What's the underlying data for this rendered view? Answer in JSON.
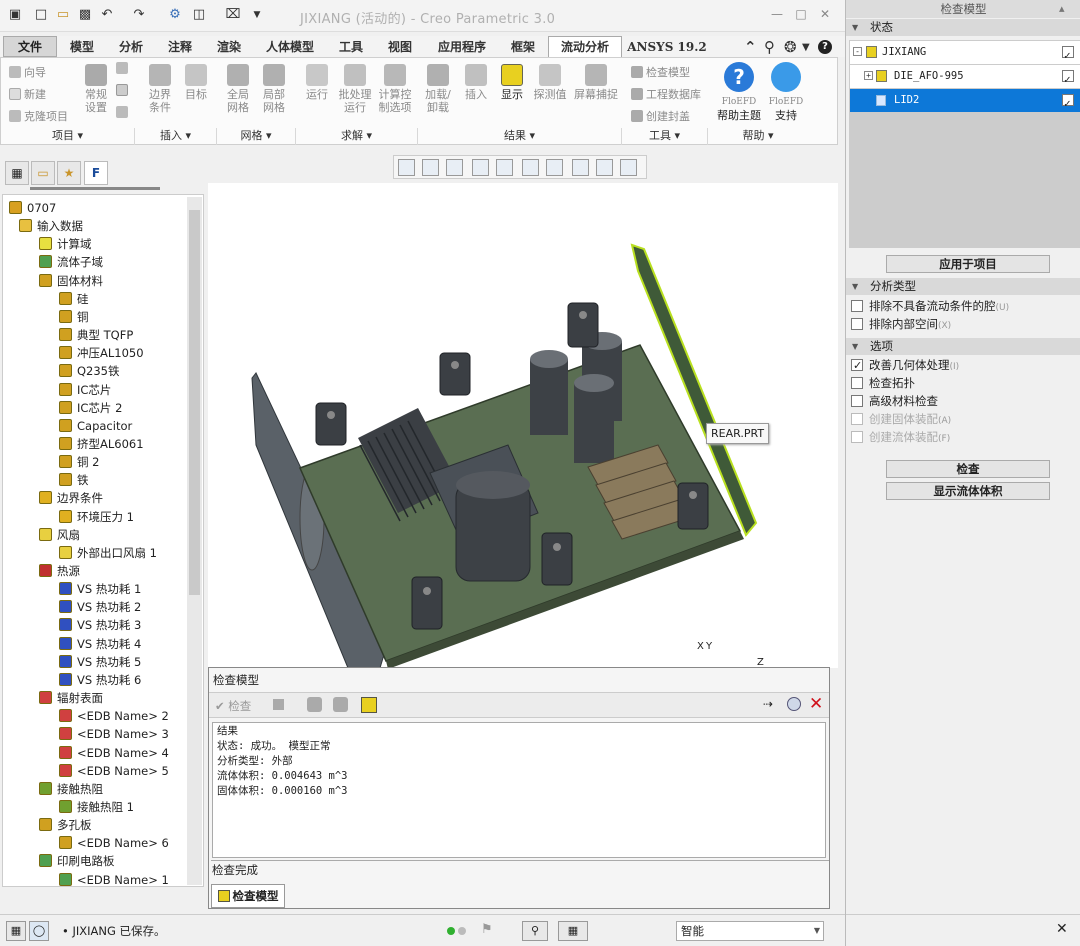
{
  "app": {
    "title": "JIXIANG (活动的) - Creo Parametric 3.0"
  },
  "quick_access": [
    "app-icon",
    "new-icon",
    "open-icon",
    "save-icon",
    "undo-icon",
    "redo-icon",
    "regenerate-icon",
    "window-icon",
    "close-window-icon",
    "customize-icon"
  ],
  "tabs": [
    "文件",
    "模型",
    "分析",
    "注释",
    "渲染",
    "人体模型",
    "工具",
    "视图",
    "应用程序",
    "框架",
    "流动分析",
    "ANSYS 19.2"
  ],
  "ribbon": {
    "project_small": [
      "向导",
      "新建",
      "克隆项目"
    ],
    "project_large": [
      [
        "常规",
        "设置"
      ]
    ],
    "insert": [
      [
        "边界",
        "条件"
      ],
      [
        "目标",
        ""
      ]
    ],
    "mesh": [
      [
        "全局",
        "网格"
      ],
      [
        "局部",
        "网格"
      ]
    ],
    "solve": [
      [
        "运行",
        ""
      ],
      [
        "批处理",
        "运行"
      ],
      [
        "计算控",
        "制选项"
      ]
    ],
    "results": [
      [
        "加载/",
        "卸载"
      ],
      [
        "插入",
        ""
      ],
      [
        "显示",
        ""
      ],
      [
        "探测值",
        ""
      ],
      [
        "屏幕捕捉",
        ""
      ]
    ],
    "tools_small": [
      "检查模型",
      "工程数据库",
      "创建封盖"
    ],
    "help": [
      [
        "FloEFD",
        "帮助主题"
      ],
      [
        "FloEFD",
        "支持"
      ]
    ],
    "groups": [
      "项目",
      "插入",
      "网格",
      "求解",
      "结果",
      "工具",
      "帮助"
    ]
  },
  "tree": {
    "items": [
      {
        "label": "0707",
        "level": 0,
        "color": "#d8a020"
      },
      {
        "label": "输入数据",
        "level": 1,
        "color": "#e8c040"
      },
      {
        "label": "计算域",
        "level": 2,
        "color": "#e8e040"
      },
      {
        "label": "流体子域",
        "level": 2,
        "color": "#50a050"
      },
      {
        "label": "固体材料",
        "level": 2,
        "color": "#d0a020"
      },
      {
        "label": "硅",
        "level": 3,
        "color": "#d0a020"
      },
      {
        "label": "铜",
        "level": 3,
        "color": "#d0a020"
      },
      {
        "label": "典型 TQFP",
        "level": 3,
        "color": "#d0a020"
      },
      {
        "label": "冲压AL1050",
        "level": 3,
        "color": "#d0a020"
      },
      {
        "label": "Q235铁",
        "level": 3,
        "color": "#d0a020"
      },
      {
        "label": "IC芯片",
        "level": 3,
        "color": "#d0a020"
      },
      {
        "label": "IC芯片 2",
        "level": 3,
        "color": "#d0a020"
      },
      {
        "label": "Capacitor",
        "level": 3,
        "color": "#d0a020"
      },
      {
        "label": "挤型AL6061",
        "level": 3,
        "color": "#d0a020"
      },
      {
        "label": "铜 2",
        "level": 3,
        "color": "#d0a020"
      },
      {
        "label": "铁",
        "level": 3,
        "color": "#d0a020"
      },
      {
        "label": "边界条件",
        "level": 2,
        "color": "#e0b020"
      },
      {
        "label": "环境压力 1",
        "level": 3,
        "color": "#e0b020"
      },
      {
        "label": "风扇",
        "level": 2,
        "color": "#e8d040"
      },
      {
        "label": "外部出口风扇 1",
        "level": 3,
        "color": "#e8d040"
      },
      {
        "label": "热源",
        "level": 2,
        "color": "#c03030"
      },
      {
        "label": "VS 热功耗 1",
        "level": 3,
        "color": "#3050c0"
      },
      {
        "label": "VS 热功耗 2",
        "level": 3,
        "color": "#3050c0"
      },
      {
        "label": "VS 热功耗 3",
        "level": 3,
        "color": "#3050c0"
      },
      {
        "label": "VS 热功耗 4",
        "level": 3,
        "color": "#3050c0"
      },
      {
        "label": "VS 热功耗 5",
        "level": 3,
        "color": "#3050c0"
      },
      {
        "label": "VS 热功耗 6",
        "level": 3,
        "color": "#3050c0"
      },
      {
        "label": "辐射表面",
        "level": 2,
        "color": "#d04040"
      },
      {
        "label": "<EDB Name> 2",
        "level": 3,
        "color": "#d04040"
      },
      {
        "label": "<EDB Name> 3",
        "level": 3,
        "color": "#d04040"
      },
      {
        "label": "<EDB Name> 4",
        "level": 3,
        "color": "#d04040"
      },
      {
        "label": "<EDB Name> 5",
        "level": 3,
        "color": "#d04040"
      },
      {
        "label": "接触热阻",
        "level": 2,
        "color": "#70a030"
      },
      {
        "label": "接触热阻 1",
        "level": 3,
        "color": "#70a030"
      },
      {
        "label": "多孔板",
        "level": 2,
        "color": "#d0a020"
      },
      {
        "label": "<EDB Name> 6",
        "level": 3,
        "color": "#d0a020"
      },
      {
        "label": "印刷电路板",
        "level": 2,
        "color": "#50a050"
      },
      {
        "label": "<EDB Name> 1",
        "level": 3,
        "color": "#50a050"
      }
    ]
  },
  "viewport": {
    "tooltip": "REAR.PRT",
    "axis_x": "X",
    "axis_y": "Y",
    "axis_z": "Z"
  },
  "right_panel": {
    "title": "检查模型",
    "status_label": "状态",
    "status_items": [
      {
        "label": "JIXIANG",
        "checked": true
      },
      {
        "label": "DIE_AFO-995",
        "checked": true
      },
      {
        "label": "LID2",
        "checked": true
      }
    ],
    "apply_button": "应用于项目",
    "analysis_label": "分析类型",
    "analysis_opts": [
      {
        "label": "排除不具备流动条件的腔",
        "key": "(U)",
        "checked": false,
        "disabled": false
      },
      {
        "label": "排除内部空间",
        "key": "(X)",
        "checked": false,
        "disabled": false
      }
    ],
    "options_label": "选项",
    "options": [
      {
        "label": "改善几何体处理",
        "key": "(I)",
        "checked": true,
        "disabled": false
      },
      {
        "label": "检查拓扑",
        "key": "",
        "checked": false,
        "disabled": false
      },
      {
        "label": "高级材料检查",
        "key": "",
        "checked": false,
        "disabled": false
      },
      {
        "label": "创建固体装配",
        "key": "(A)",
        "checked": false,
        "disabled": true
      },
      {
        "label": "创建流体装配",
        "key": "(F)",
        "checked": false,
        "disabled": true
      }
    ],
    "check_button": "检查",
    "show_fluid_button": "显示流体体积"
  },
  "dialog": {
    "title": "检查模型",
    "check_label": "检查",
    "result_lines": [
      "结果",
      "状态: 成功。 模型正常",
      "分析类型: 外部",
      "流体体积: 0.004643 m^3",
      "固体体积: 0.000160 m^3"
    ],
    "status": "检查完成",
    "tab": "检查模型"
  },
  "statusbar": {
    "message": "JIXIANG 已保存。",
    "filter": "智能"
  },
  "colors": {
    "accent": "#0d78d8",
    "pcb": "#5a6e52",
    "component": "#3d4146"
  }
}
